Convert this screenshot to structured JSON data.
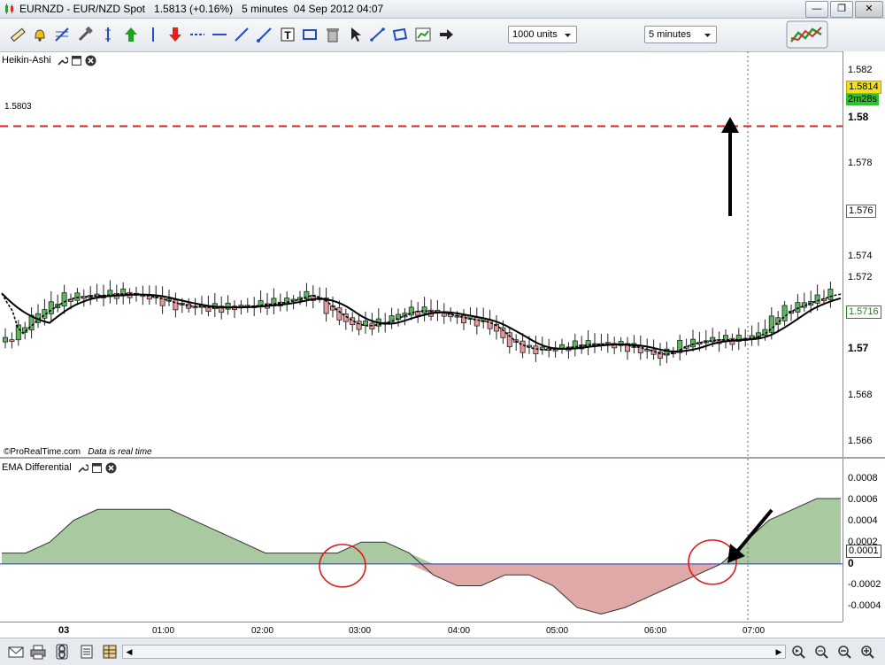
{
  "window": {
    "title": "EURNZD - EUR/NZD Spot   1.5813 (+0.16%)   5 minutes  04 Sep 2012 04:07"
  },
  "toolbar": {
    "units_select": "1000 units",
    "timeframe_select": "5 minutes",
    "tools": [
      "ruler-icon",
      "alert-bell-icon",
      "fibonacci-icon",
      "hammer-icon",
      "vertical-line-icon",
      "buy-arrow-icon",
      "vertical-line-icon",
      "sell-arrow-icon",
      "horizontal-segment-icon",
      "horizontal-segment-icon",
      "trendline-icon",
      "trendline-icon",
      "text-icon",
      "rectangle-icon",
      "trash-icon",
      "pointer-icon",
      "pencil-line-icon",
      "lasso-icon",
      "chart-settings-icon",
      "arrow-right-icon"
    ]
  },
  "main_panel": {
    "title": "Heikin-Ashi",
    "target_line_label": "1.5803",
    "copyright": "©ProRealTime.com",
    "realtime_note": "Data is real time",
    "price_axis": [
      "1.582",
      "1.58",
      "1.578",
      "1.576",
      "1.574",
      "1.572",
      "1.57",
      "1.568",
      "1.566"
    ],
    "current_price": "1.5814",
    "countdown": "2m28s",
    "ema_value": "1.5716"
  },
  "sub_panel": {
    "title": "EMA Differential",
    "axis": [
      "0.0008",
      "0.0006",
      "0.0004",
      "0.0002",
      "0.0001",
      "0",
      "-0.0002",
      "-0.0004"
    ]
  },
  "time_axis": [
    "03",
    "01:00",
    "02:00",
    "03:00",
    "04:00",
    "05:00",
    "06:00",
    "07:00"
  ],
  "colors": {
    "bull": "#5cb85c",
    "bear": "#e59a9a",
    "positive_fill": "#a9c9a0",
    "negative_fill": "#dfa9a7",
    "target_line": "#e02020",
    "marker_circle": "#e01818"
  },
  "chart_data": {
    "type": "candlestick",
    "title": "Heikin-Ashi",
    "ylim": [
      1.565,
      1.583
    ],
    "target_level": 1.5803,
    "x_ticks": [
      "03",
      "01:00",
      "02:00",
      "03:00",
      "04:00",
      "05:00",
      "06:00",
      "07:00"
    ],
    "indicator": {
      "name": "EMA Differential",
      "ylim": [
        -0.00048,
        0.0009
      ],
      "values": [
        0.0001,
        0.0001,
        0.0002,
        0.0004,
        0.0005,
        0.0005,
        0.0005,
        0.0005,
        0.0004,
        0.0003,
        0.0002,
        0.0001,
        0.0001,
        0.0001,
        0.0001,
        0.0002,
        0.0002,
        0.0001,
        -0.0001,
        -0.0002,
        -0.0002,
        -0.0001,
        -0.0001,
        -0.0002,
        -0.0004,
        -0.00046,
        -0.0004,
        -0.0003,
        -0.0002,
        -0.0001,
        0,
        0.0002,
        0.0004,
        0.0005,
        0.0006,
        0.0006
      ]
    }
  }
}
